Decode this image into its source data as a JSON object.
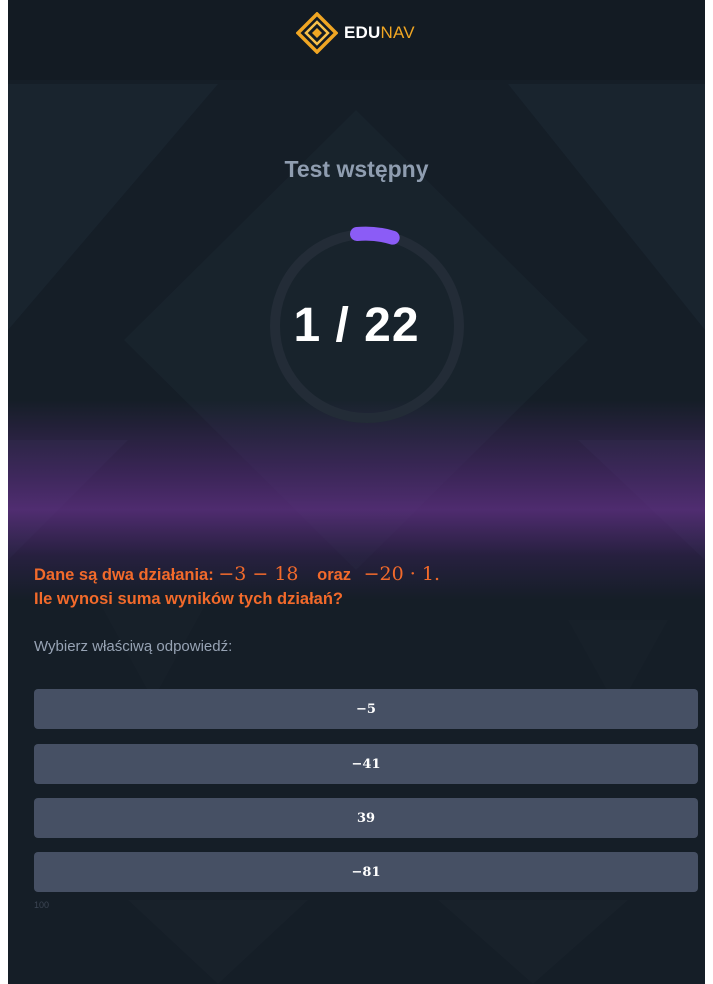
{
  "header": {
    "brand_bold": "EDU",
    "brand_light": "NAV",
    "logo_icon": "diamond-logo-icon"
  },
  "quiz": {
    "title": "Test wstępny",
    "counter": "1 / 22",
    "progress_fraction": 0.045,
    "question": {
      "intro": "Dane są dwa działania:",
      "expr1": "−3 − 18",
      "conjunction": "oraz",
      "expr2": "−20 · 1.",
      "line2": "Ile wynosi suma wyników tych działań?"
    },
    "hint": "Wybierz właściwą odpowiedź:",
    "answers": [
      "−5",
      "−41",
      "39",
      "−81"
    ],
    "footnote": "100"
  },
  "colors": {
    "background": "#151e27",
    "accent_orange": "#f26a2b",
    "progress_purple": "#8b5cf6",
    "answer_bg": "#465064",
    "logo_gold": "#f0a623"
  }
}
